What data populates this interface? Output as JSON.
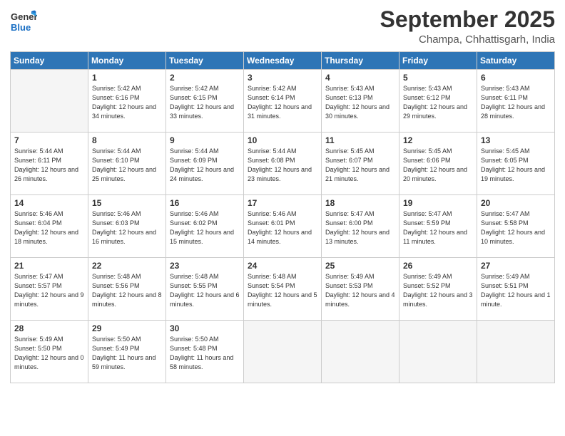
{
  "logo": {
    "general": "General",
    "blue": "Blue"
  },
  "header": {
    "month": "September 2025",
    "location": "Champa, Chhattisgarh, India"
  },
  "weekdays": [
    "Sunday",
    "Monday",
    "Tuesday",
    "Wednesday",
    "Thursday",
    "Friday",
    "Saturday"
  ],
  "weeks": [
    [
      {
        "day": null
      },
      {
        "day": 1,
        "sunrise": "5:42 AM",
        "sunset": "6:16 PM",
        "daylight": "12 hours and 34 minutes."
      },
      {
        "day": 2,
        "sunrise": "5:42 AM",
        "sunset": "6:15 PM",
        "daylight": "12 hours and 33 minutes."
      },
      {
        "day": 3,
        "sunrise": "5:42 AM",
        "sunset": "6:14 PM",
        "daylight": "12 hours and 31 minutes."
      },
      {
        "day": 4,
        "sunrise": "5:43 AM",
        "sunset": "6:13 PM",
        "daylight": "12 hours and 30 minutes."
      },
      {
        "day": 5,
        "sunrise": "5:43 AM",
        "sunset": "6:12 PM",
        "daylight": "12 hours and 29 minutes."
      },
      {
        "day": 6,
        "sunrise": "5:43 AM",
        "sunset": "6:11 PM",
        "daylight": "12 hours and 28 minutes."
      }
    ],
    [
      {
        "day": 7,
        "sunrise": "5:44 AM",
        "sunset": "6:11 PM",
        "daylight": "12 hours and 26 minutes."
      },
      {
        "day": 8,
        "sunrise": "5:44 AM",
        "sunset": "6:10 PM",
        "daylight": "12 hours and 25 minutes."
      },
      {
        "day": 9,
        "sunrise": "5:44 AM",
        "sunset": "6:09 PM",
        "daylight": "12 hours and 24 minutes."
      },
      {
        "day": 10,
        "sunrise": "5:44 AM",
        "sunset": "6:08 PM",
        "daylight": "12 hours and 23 minutes."
      },
      {
        "day": 11,
        "sunrise": "5:45 AM",
        "sunset": "6:07 PM",
        "daylight": "12 hours and 21 minutes."
      },
      {
        "day": 12,
        "sunrise": "5:45 AM",
        "sunset": "6:06 PM",
        "daylight": "12 hours and 20 minutes."
      },
      {
        "day": 13,
        "sunrise": "5:45 AM",
        "sunset": "6:05 PM",
        "daylight": "12 hours and 19 minutes."
      }
    ],
    [
      {
        "day": 14,
        "sunrise": "5:46 AM",
        "sunset": "6:04 PM",
        "daylight": "12 hours and 18 minutes."
      },
      {
        "day": 15,
        "sunrise": "5:46 AM",
        "sunset": "6:03 PM",
        "daylight": "12 hours and 16 minutes."
      },
      {
        "day": 16,
        "sunrise": "5:46 AM",
        "sunset": "6:02 PM",
        "daylight": "12 hours and 15 minutes."
      },
      {
        "day": 17,
        "sunrise": "5:46 AM",
        "sunset": "6:01 PM",
        "daylight": "12 hours and 14 minutes."
      },
      {
        "day": 18,
        "sunrise": "5:47 AM",
        "sunset": "6:00 PM",
        "daylight": "12 hours and 13 minutes."
      },
      {
        "day": 19,
        "sunrise": "5:47 AM",
        "sunset": "5:59 PM",
        "daylight": "12 hours and 11 minutes."
      },
      {
        "day": 20,
        "sunrise": "5:47 AM",
        "sunset": "5:58 PM",
        "daylight": "12 hours and 10 minutes."
      }
    ],
    [
      {
        "day": 21,
        "sunrise": "5:47 AM",
        "sunset": "5:57 PM",
        "daylight": "12 hours and 9 minutes."
      },
      {
        "day": 22,
        "sunrise": "5:48 AM",
        "sunset": "5:56 PM",
        "daylight": "12 hours and 8 minutes."
      },
      {
        "day": 23,
        "sunrise": "5:48 AM",
        "sunset": "5:55 PM",
        "daylight": "12 hours and 6 minutes."
      },
      {
        "day": 24,
        "sunrise": "5:48 AM",
        "sunset": "5:54 PM",
        "daylight": "12 hours and 5 minutes."
      },
      {
        "day": 25,
        "sunrise": "5:49 AM",
        "sunset": "5:53 PM",
        "daylight": "12 hours and 4 minutes."
      },
      {
        "day": 26,
        "sunrise": "5:49 AM",
        "sunset": "5:52 PM",
        "daylight": "12 hours and 3 minutes."
      },
      {
        "day": 27,
        "sunrise": "5:49 AM",
        "sunset": "5:51 PM",
        "daylight": "12 hours and 1 minute."
      }
    ],
    [
      {
        "day": 28,
        "sunrise": "5:49 AM",
        "sunset": "5:50 PM",
        "daylight": "12 hours and 0 minutes."
      },
      {
        "day": 29,
        "sunrise": "5:50 AM",
        "sunset": "5:49 PM",
        "daylight": "11 hours and 59 minutes."
      },
      {
        "day": 30,
        "sunrise": "5:50 AM",
        "sunset": "5:48 PM",
        "daylight": "11 hours and 58 minutes."
      },
      {
        "day": null
      },
      {
        "day": null
      },
      {
        "day": null
      },
      {
        "day": null
      }
    ]
  ]
}
